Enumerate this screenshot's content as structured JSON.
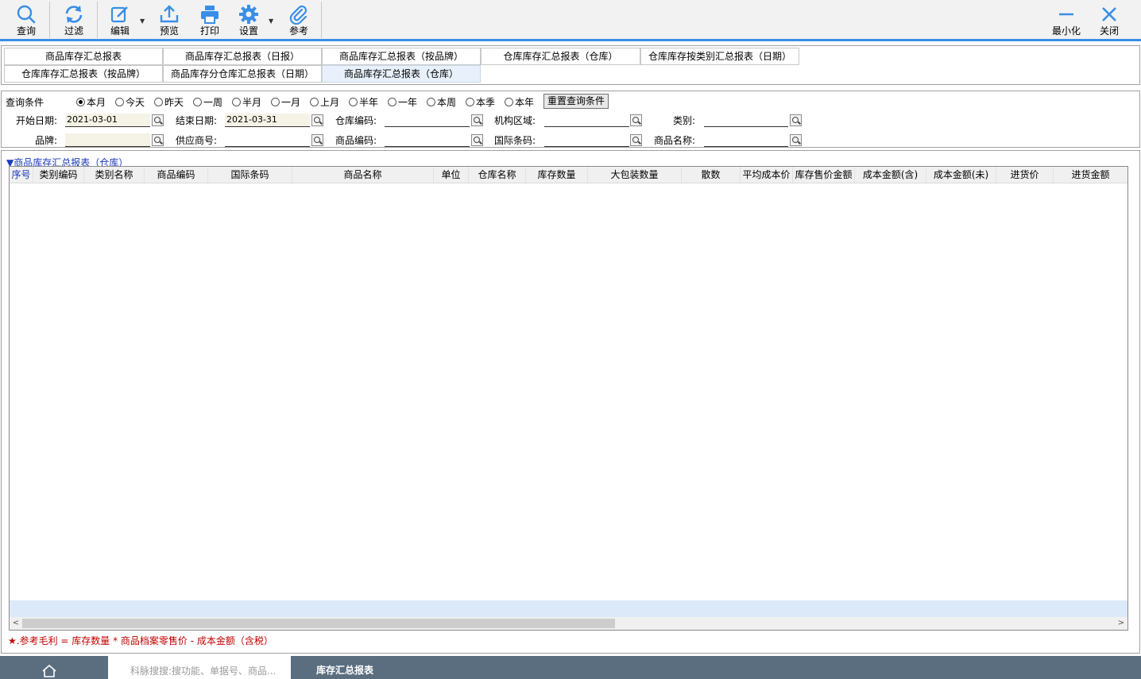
{
  "toolbar": {
    "query": "查询",
    "filter": "过滤",
    "edit": "编辑",
    "preview": "预览",
    "print": "打印",
    "settings": "设置",
    "reference": "参考",
    "minimize": "最小化",
    "close": "关闭",
    "accent_color": "#3a8ee6"
  },
  "report_tabs": [
    "商品库存汇总报表",
    "商品库存汇总报表（日报）",
    "商品库存汇总报表（按品牌）",
    "仓库库存汇总报表（仓库）",
    "仓库库存按类别汇总报表（日期）",
    "仓库库存汇总报表（按品牌）",
    "商品库存分仓库汇总报表（日期）",
    "商品库存汇总报表（仓库）"
  ],
  "active_tab": "商品库存汇总报表（仓库）",
  "query": {
    "label": "查询条件",
    "ranges": [
      "本月",
      "今天",
      "昨天",
      "一周",
      "半月",
      "一月",
      "上月",
      "半年",
      "一年",
      "本周",
      "本季",
      "本年"
    ],
    "selected_range": "本月",
    "reset": "重置查询条件",
    "start_date_label": "开始日期:",
    "start_date": "2021-03-01",
    "end_date_label": "结束日期:",
    "end_date": "2021-03-31",
    "warehouse_code_label": "仓库编码:",
    "org_area_label": "机构区域:",
    "category_label": "类别:",
    "brand_label": "品牌:",
    "supplier_label": "供应商号:",
    "product_code_label": "商品编码:",
    "barcode_label": "国际条码:",
    "product_name_label": "商品名称:"
  },
  "grid": {
    "title": "▼商品库存汇总报表（仓库）",
    "columns": [
      "序号",
      "类别编码",
      "类别名称",
      "商品编码",
      "国际条码",
      "商品名称",
      "单位",
      "仓库名称",
      "库存数量",
      "大包装数量",
      "散数",
      "平均成本价",
      "库存售价金额",
      "成本金额(含)",
      "成本金额(未)",
      "进货价",
      "进货金额"
    ],
    "rows": []
  },
  "note": "★.参考毛利 = 库存数量 * 商品档案零售价 - 成本金额（含税）",
  "taskbar": {
    "search_placeholder": "科脉搜搜:搜功能、单据号、商品...",
    "current_tab": "库存汇总报表"
  }
}
